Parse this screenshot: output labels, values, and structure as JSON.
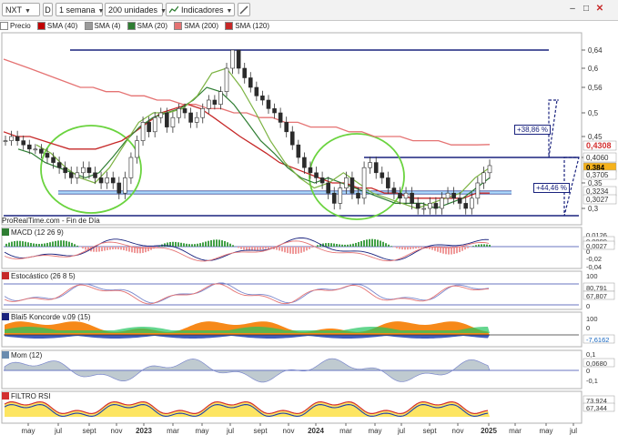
{
  "toolbar": {
    "ticker": "NXT",
    "d_button": "D",
    "period": "1 semana",
    "units": "200 unidades",
    "indicators": "Indicadores"
  },
  "legend": [
    {
      "label": "Precio",
      "color": "#2b2b2b"
    },
    {
      "label": "SMA (40)",
      "color": "#c00000"
    },
    {
      "label": "SMA (4)",
      "color": "#9a9a9a"
    },
    {
      "label": "SMA (20)",
      "color": "#2e7d32"
    },
    {
      "label": "SMA (200)",
      "color": "#e57373"
    },
    {
      "label": "SMA (120)",
      "color": "#c62828"
    }
  ],
  "watermark": "ProRealTime.com - Fin de Día",
  "panels": {
    "macd": "MACD (12 26 9)",
    "stoch": "Estocástico (26 8 5)",
    "blai": "Blai5 Koncorde v.09 (15)",
    "mom": "Mom (12)",
    "rsi": "FILTRO RSI"
  },
  "annotations": {
    "pct_up_1": "+38,86 %",
    "pct_up_2": "+44,46 %"
  },
  "chart_data": [
    {
      "type": "line",
      "title": "NXT",
      "y_ticks": [
        0.64,
        0.6,
        0.56,
        0.5,
        0.45,
        0.4,
        0.35,
        0.3
      ],
      "y_tick_labels": [
        "0,64",
        "0,6",
        "0,56",
        "0,5",
        "0,45",
        "0,4",
        "0,35",
        "0,3"
      ],
      "price_tags": [
        {
          "value": 0.4308,
          "label": "0,4308",
          "color": "#d32f2f",
          "bg": "#ffffff"
        },
        {
          "value": 0.406,
          "label": "0,4060",
          "color": "#333333",
          "bg": "#ffffff"
        },
        {
          "value": 0.384,
          "label": "0,384",
          "color": "#000000",
          "bg": "#f5b21b"
        },
        {
          "value": 0.3705,
          "label": "0,3705",
          "color": "#333333",
          "bg": "#ffffff"
        },
        {
          "value": 0.3234,
          "label": "0,3234",
          "color": "#333333",
          "bg": "#ffffff"
        },
        {
          "value": 0.3027,
          "label": "0,3027",
          "color": "#333333",
          "bg": "#ffffff"
        }
      ],
      "x_labels": [
        "may",
        "jul",
        "sept",
        "nov",
        "2023",
        "mar",
        "may",
        "jul",
        "sept",
        "nov",
        "2024",
        "mar",
        "may",
        "jul",
        "sept",
        "nov",
        "2025",
        "mar",
        "may",
        "jul"
      ],
      "price": [
        0.44,
        0.45,
        0.44,
        0.43,
        0.42,
        0.42,
        0.41,
        0.4,
        0.39,
        0.38,
        0.37,
        0.36,
        0.37,
        0.38,
        0.37,
        0.36,
        0.35,
        0.36,
        0.35,
        0.33,
        0.36,
        0.4,
        0.44,
        0.48,
        0.46,
        0.49,
        0.5,
        0.47,
        0.49,
        0.51,
        0.5,
        0.48,
        0.49,
        0.51,
        0.53,
        0.52,
        0.55,
        0.6,
        0.64,
        0.6,
        0.58,
        0.56,
        0.54,
        0.53,
        0.51,
        0.5,
        0.48,
        0.46,
        0.43,
        0.4,
        0.38,
        0.37,
        0.36,
        0.35,
        0.33,
        0.31,
        0.34,
        0.36,
        0.33,
        0.32,
        0.38,
        0.39,
        0.37,
        0.36,
        0.34,
        0.33,
        0.32,
        0.33,
        0.31,
        0.3,
        0.3,
        0.31,
        0.3,
        0.32,
        0.33,
        0.32,
        0.31,
        0.3,
        0.32,
        0.35,
        0.37,
        0.384
      ],
      "sma_200": [
        0.62,
        0.61,
        0.6,
        0.59,
        0.58,
        0.57,
        0.56,
        0.56,
        0.55,
        0.55,
        0.54,
        0.54,
        0.53,
        0.53,
        0.52,
        0.52,
        0.51,
        0.51,
        0.5,
        0.5,
        0.49,
        0.49,
        0.48,
        0.48,
        0.47,
        0.47,
        0.47,
        0.46,
        0.46,
        0.45,
        0.45,
        0.45,
        0.44,
        0.44,
        0.44,
        0.43,
        0.43,
        0.43,
        0.4308
      ],
      "sma_120": [
        0.46,
        0.45,
        0.45,
        0.44,
        0.43,
        0.42,
        0.42,
        0.42,
        0.43,
        0.44,
        0.46,
        0.48,
        0.5,
        0.51,
        0.52,
        0.51,
        0.49,
        0.47,
        0.45,
        0.43,
        0.41,
        0.39,
        0.38,
        0.37,
        0.36,
        0.35,
        0.35,
        0.34,
        0.34,
        0.33,
        0.33,
        0.32,
        0.32,
        0.32,
        0.32,
        0.32,
        0.33,
        0.33
      ],
      "sma_40": [
        0.42,
        0.41,
        0.39,
        0.38,
        0.37,
        0.36,
        0.37,
        0.4,
        0.44,
        0.47,
        0.49,
        0.5,
        0.51,
        0.53,
        0.56,
        0.55,
        0.52,
        0.48,
        0.44,
        0.41,
        0.38,
        0.36,
        0.35,
        0.36,
        0.35,
        0.34,
        0.33,
        0.32,
        0.31,
        0.31,
        0.31,
        0.3,
        0.31,
        0.32,
        0.34,
        0.36
      ],
      "sma_20": [
        0.43,
        0.41,
        0.38,
        0.36,
        0.35,
        0.38,
        0.43,
        0.48,
        0.5,
        0.5,
        0.51,
        0.54,
        0.59,
        0.6,
        0.56,
        0.5,
        0.44,
        0.39,
        0.36,
        0.34,
        0.35,
        0.37,
        0.35,
        0.33,
        0.32,
        0.31,
        0.3,
        0.31,
        0.32,
        0.33,
        0.36,
        0.38
      ]
    },
    {
      "type": "bar",
      "title": "MACD (12 26 9)",
      "y_tick_labels": [
        "0,0126",
        "0,0099",
        "0,0027",
        "0",
        "-0,02",
        "-0,04"
      ]
    },
    {
      "type": "line",
      "title": "Estocástico (26 8 5)",
      "y_tick_labels": [
        "100",
        "80,791",
        "67,807",
        "0"
      ]
    },
    {
      "type": "area",
      "title": "Blai5 Koncorde v.09 (15)",
      "y_tick_labels": [
        "100",
        "0",
        "-7,6162"
      ]
    },
    {
      "type": "area",
      "title": "Mom (12)",
      "y_tick_labels": [
        "0,1",
        "0,0680",
        "0",
        "-0,1"
      ]
    },
    {
      "type": "area",
      "title": "FILTRO RSI",
      "y_tick_labels": [
        "73,924",
        "67,344"
      ]
    }
  ]
}
